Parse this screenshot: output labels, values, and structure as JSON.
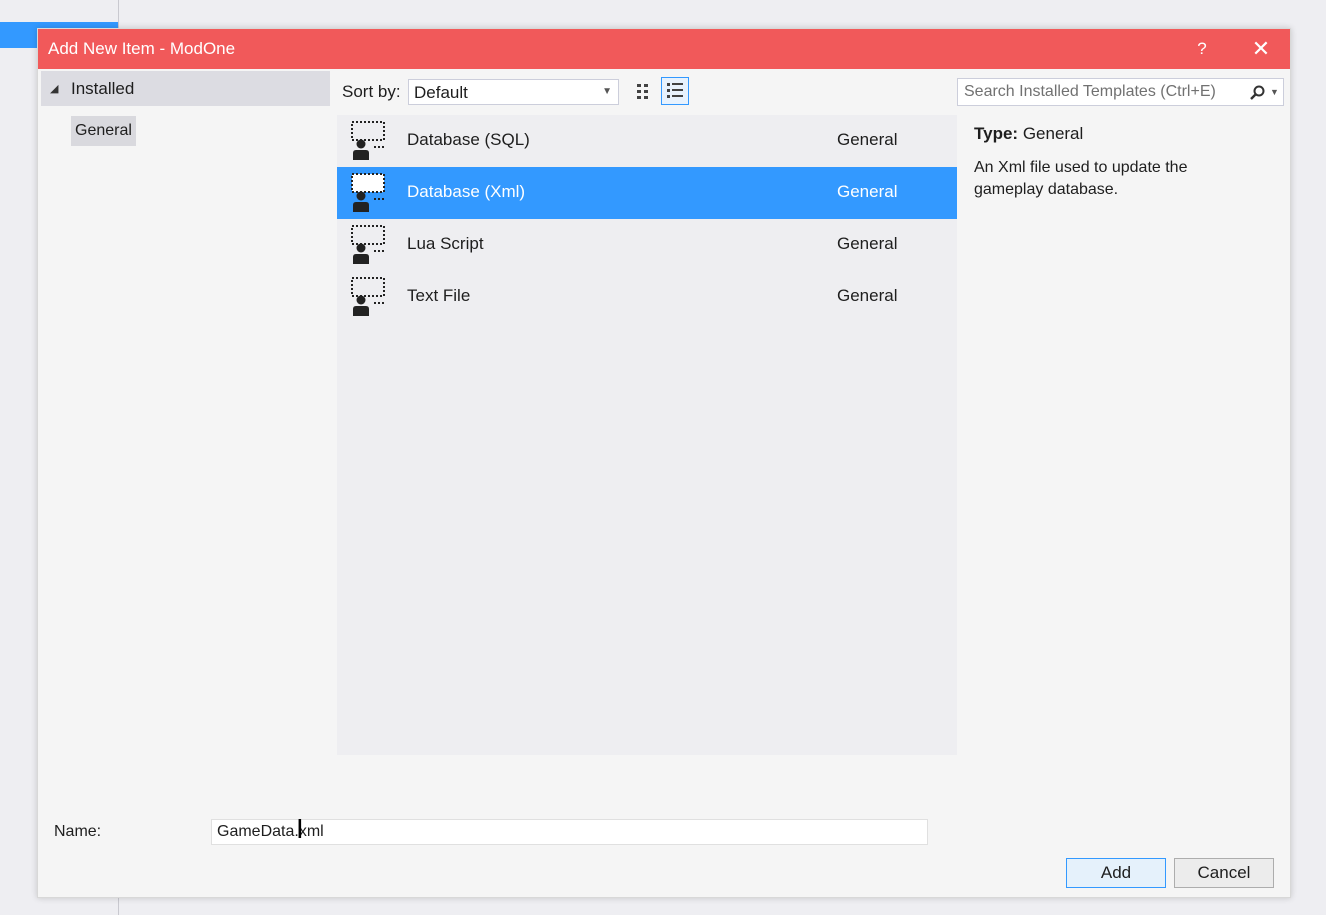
{
  "window": {
    "title": "Add New Item - ModOne",
    "help_label": "?",
    "close_label": "✕"
  },
  "tree": {
    "root_arrow": "◢",
    "root_label": "Installed",
    "children": [
      "General"
    ]
  },
  "toolbar": {
    "sort_label": "Sort by:",
    "sort_value": "Default",
    "views": [
      "grid-view-icon",
      "list-view-icon"
    ],
    "active_view": "list-view-icon"
  },
  "search": {
    "placeholder": "Search Installed Templates (Ctrl+E)",
    "icon": "search-icon"
  },
  "templates": [
    {
      "name": "Database (SQL)",
      "category": "General",
      "selected": false
    },
    {
      "name": "Database (Xml)",
      "category": "General",
      "selected": true
    },
    {
      "name": "Lua Script",
      "category": "General",
      "selected": false
    },
    {
      "name": "Text File",
      "category": "General",
      "selected": false
    }
  ],
  "details": {
    "type_label": "Type:",
    "type_value": "General",
    "description": "An Xml file used to update the gameplay database."
  },
  "form": {
    "name_label": "Name:",
    "name_value": "GameData.xml"
  },
  "buttons": {
    "add": "Add",
    "cancel": "Cancel"
  },
  "colors": {
    "titlebar": "#f1595a",
    "selection": "#3399ff"
  }
}
